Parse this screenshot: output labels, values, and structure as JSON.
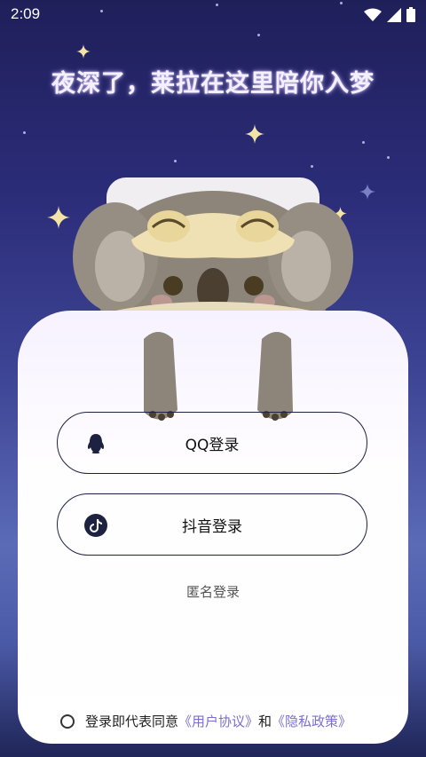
{
  "status": {
    "time": "2:09"
  },
  "headline": "夜深了，莱拉在这里陪你入梦",
  "login": {
    "qq_label": "QQ登录",
    "douyin_label": "抖音登录",
    "anonymous_label": "匿名登录"
  },
  "agreement": {
    "prefix": "登录即代表同意",
    "user_agreement": "《用户协议》",
    "and": "和",
    "privacy_policy": "《隐私政策》"
  },
  "icons": {
    "qq": "qq-penguin-icon",
    "douyin": "douyin-note-icon",
    "wifi": "wifi-icon",
    "signal": "signal-icon",
    "battery": "battery-icon"
  },
  "colors": {
    "sky_top": "#1f1f5a",
    "sky_mid": "#5b6bb6",
    "link": "#7a6fd0",
    "button_border": "#1d2240"
  }
}
